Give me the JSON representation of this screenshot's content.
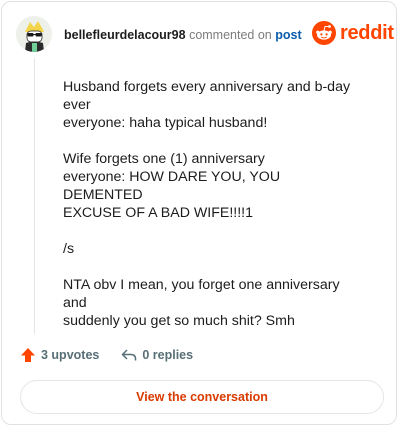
{
  "header": {
    "username": "bellefleurdelacour98",
    "commented_on_text": "commented on",
    "post_link": "post",
    "brand_wordmark": "reddit"
  },
  "comment": {
    "paragraphs": [
      "Husband forgets every anniversary and b-day\never\neveryone: haha typical husband!",
      "Wife forgets one (1) anniversary\neveryone: HOW DARE YOU, YOU DEMENTED\nEXCUSE OF A BAD WIFE!!!!1",
      "/s",
      "NTA obv I mean, you forget one anniversary and\nsuddenly you get so much shit? Smh"
    ]
  },
  "actions": {
    "upvotes_label": "3 upvotes",
    "replies_label": "0 replies"
  },
  "cta": {
    "label": "View the conversation"
  },
  "colors": {
    "brand": "#ff4500",
    "link": "#0b5cad",
    "cta_text": "#d93a00"
  },
  "icons": [
    "user-avatar",
    "reddit-logo-icon",
    "upvote-arrow-icon",
    "reply-arrow-icon"
  ]
}
